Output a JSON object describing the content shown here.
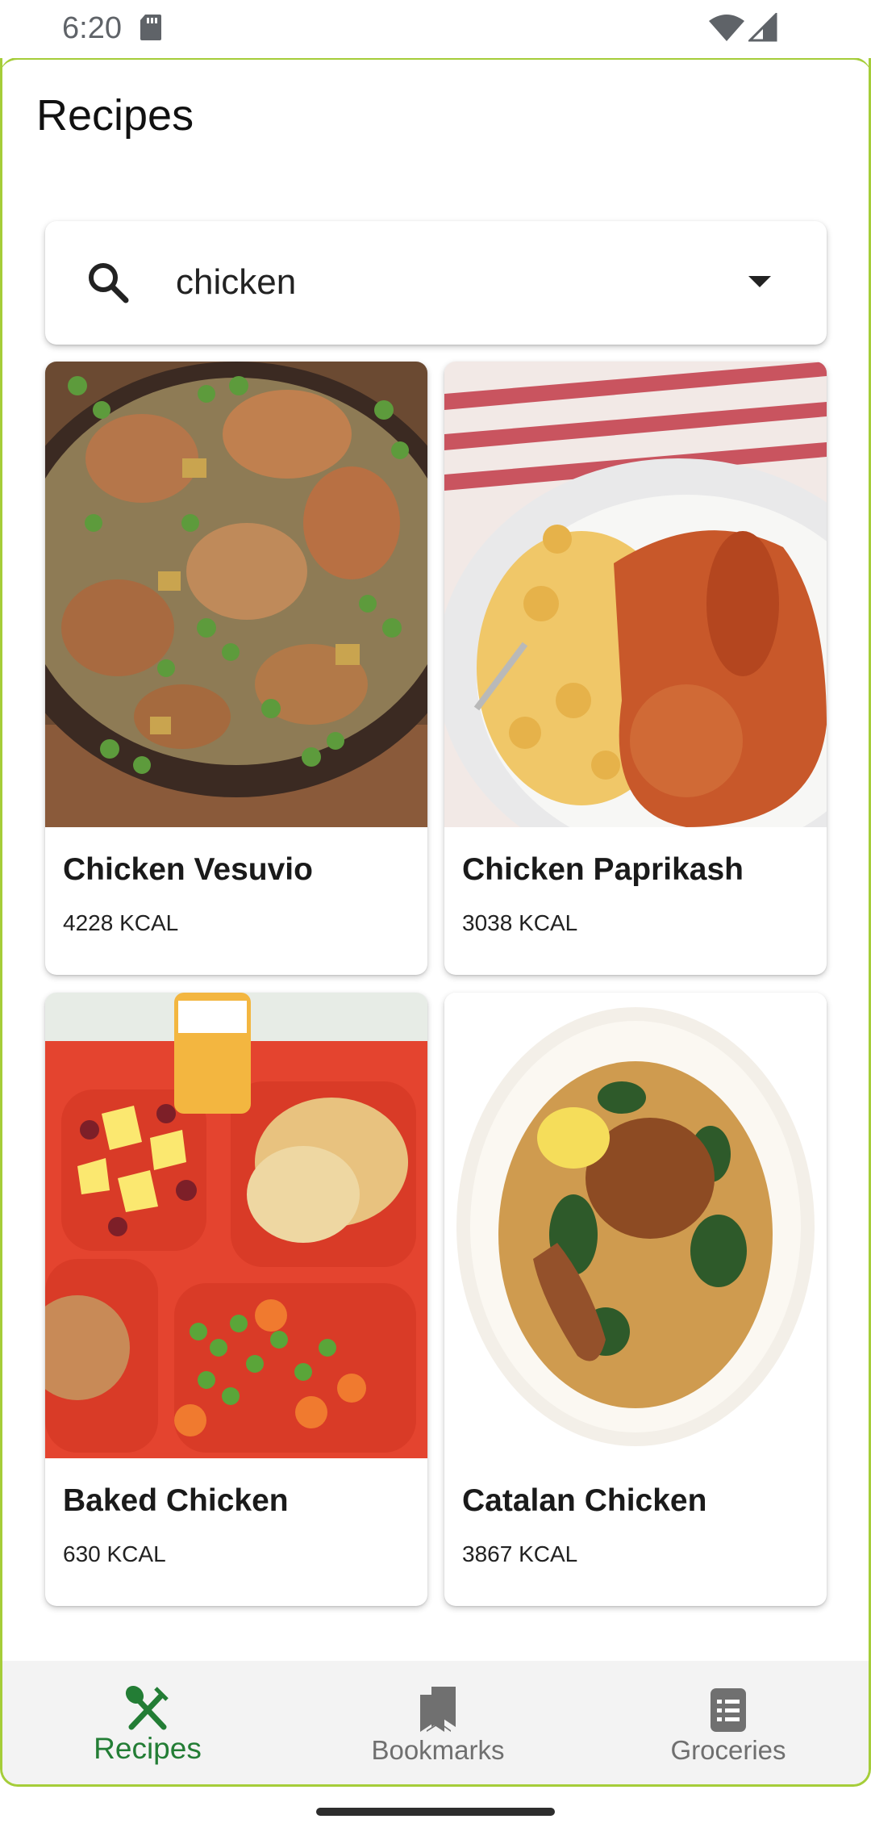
{
  "status_bar": {
    "time": "6:20"
  },
  "header": {
    "title": "Recipes"
  },
  "search": {
    "value": "chicken",
    "placeholder": ""
  },
  "recipes": [
    {
      "name": "Chicken Vesuvio",
      "kcal": "4228 KCAL"
    },
    {
      "name": "Chicken Paprikash",
      "kcal": "3038 KCAL"
    },
    {
      "name": "Baked Chicken",
      "kcal": "630 KCAL"
    },
    {
      "name": "Catalan Chicken",
      "kcal": "3867 KCAL"
    }
  ],
  "bottom_nav": {
    "items": [
      {
        "label": "Recipes",
        "icon": "fork-spoon-icon",
        "active": true
      },
      {
        "label": "Bookmarks",
        "icon": "bookmarks-icon",
        "active": false
      },
      {
        "label": "Groceries",
        "icon": "list-document-icon",
        "active": false
      }
    ]
  },
  "colors": {
    "accent": "#a5cd39",
    "nav_active": "#237d35"
  }
}
